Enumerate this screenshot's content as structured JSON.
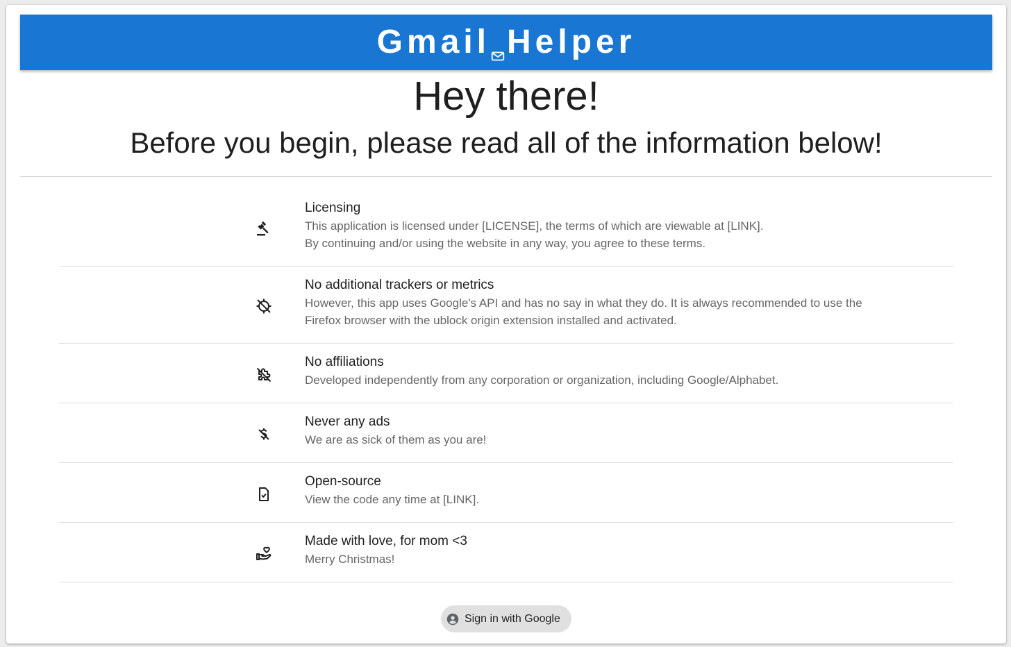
{
  "header": {
    "brand_left": "Gmail",
    "brand_right": "Helper",
    "brand_icon": "mail-icon",
    "background": "#1976d2"
  },
  "intro": {
    "greeting": "Hey there!",
    "subtitle": "Before you begin, please read all of the information below!"
  },
  "items": [
    {
      "icon": "gavel-icon",
      "title": "Licensing",
      "description": "This application is licensed under [LICENSE], the terms of which are viewable at [LINK].\nBy continuing and/or using the website in any way, you agree to these terms."
    },
    {
      "icon": "location-disabled-icon",
      "title": "No additional trackers or metrics",
      "description": "However, this app uses Google's API and has no say in what they do. It is always recommended to use the Firefox browser with the ublock origin extension installed and activated."
    },
    {
      "icon": "extension-off-icon",
      "title": "No affiliations",
      "description": "Developed independently from any corporation or organization, including Google/Alphabet."
    },
    {
      "icon": "money-off-icon",
      "title": "Never any ads",
      "description": "We are as sick of them as you are!"
    },
    {
      "icon": "file-check-icon",
      "title": "Open-source",
      "description": "View the code any time at [LINK]."
    },
    {
      "icon": "volunteer-heart-icon",
      "title": "Made with love, for mom <3",
      "description": "Merry Christmas!"
    }
  ],
  "signin": {
    "label": "Sign in with Google",
    "icon": "account-circle-icon"
  }
}
